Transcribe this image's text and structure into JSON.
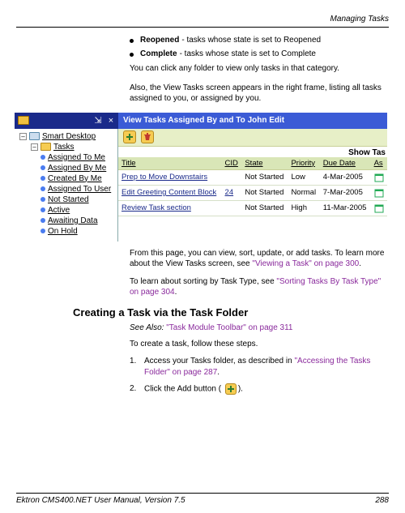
{
  "header": {
    "section": "Managing Tasks"
  },
  "bullets": [
    {
      "term": "Reopened",
      "desc": "- tasks whose state is set to Reopened"
    },
    {
      "term": "Complete",
      "desc": "- tasks whose state is set to Complete"
    }
  ],
  "intro1": "You can click any folder to view only tasks in that category.",
  "intro2": "Also, the View Tasks screen appears in the right frame, listing all tasks assigned to you, or assigned by you.",
  "shot": {
    "view_title": "View Tasks Assigned By and To John Edit",
    "show_tasks": "Show Tas",
    "tree": {
      "root": "Smart Desktop",
      "tasks": "Tasks",
      "items": [
        "Assigned To Me",
        "Assigned By Me",
        "Created By Me",
        "Assigned To User",
        "Not Started",
        "Active",
        "Awaiting Data",
        "On Hold"
      ]
    },
    "cols": {
      "title": "Title",
      "cid": "CID",
      "state": "State",
      "priority": "Priority",
      "due": "Due Date",
      "as": "As"
    },
    "rows": [
      {
        "title": "Prep to Move Downstairs",
        "cid": "",
        "state": "Not Started",
        "priority": "Low",
        "due": "4-Mar-2005"
      },
      {
        "title": "Edit Greeting Content Block",
        "cid": "24",
        "state": "Not Started",
        "priority": "Normal",
        "due": "7-Mar-2005"
      },
      {
        "title": "Review Task section",
        "cid": "",
        "state": "Not Started",
        "priority": "High",
        "due": "11-Mar-2005"
      }
    ]
  },
  "after1_a": "From this page, you can view, sort, update, or add tasks. To learn more about the View Tasks screen, see ",
  "after1_link": "\"Viewing a Task\" on page 300",
  "after1_b": ".",
  "after2_a": "To learn about sorting by Task Type, see ",
  "after2_link": "\"Sorting Tasks By Task Type\" on page 304",
  "after2_b": ".",
  "heading": "Creating a Task via the Task Folder",
  "seealso_a": "See Also: ",
  "seealso_link": "\"Task Module Toolbar\" on page 311",
  "create_intro": "To create a task, follow these steps.",
  "steps": {
    "s1_a": "Access your Tasks folder, as described in ",
    "s1_link": "\"Accessing the Tasks Folder\" on page 287",
    "s1_b": ".",
    "s2_a": "Click the Add button ( ",
    "s2_b": ")."
  },
  "footer": {
    "left": "Ektron CMS400.NET User Manual, Version 7.5",
    "right": "288"
  }
}
